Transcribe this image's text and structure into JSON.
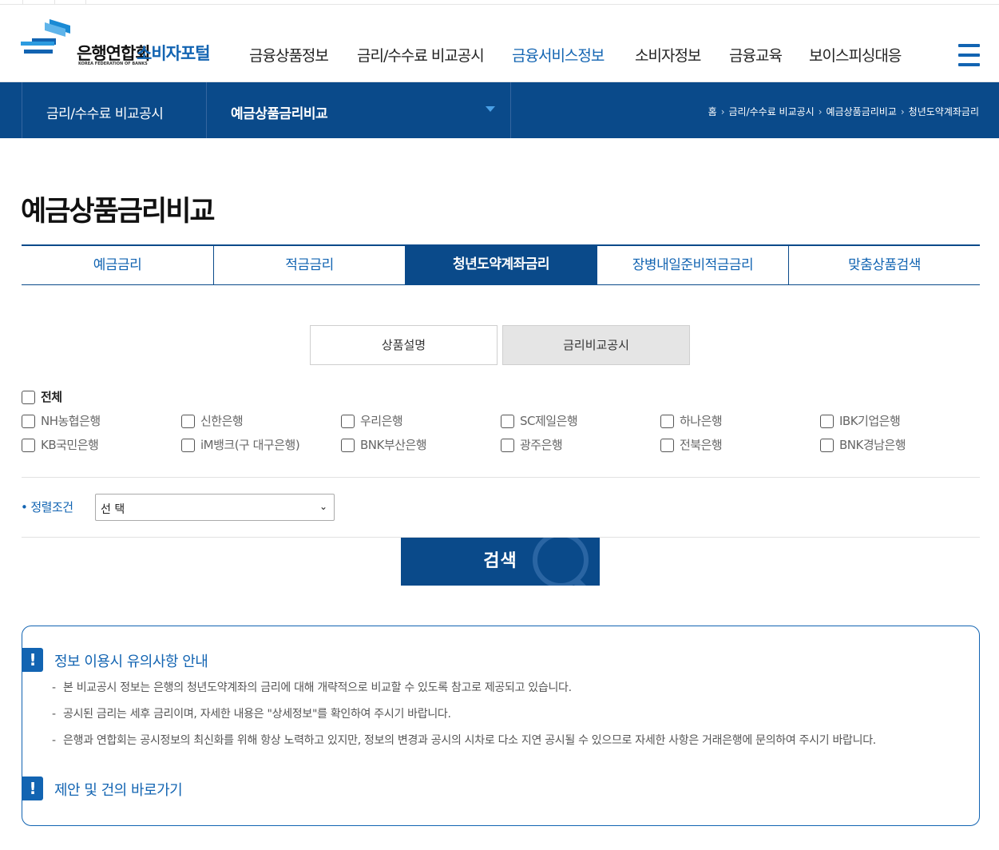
{
  "logo": {
    "org_name": "은행연합회",
    "org_name_en": "KOREA FEDERATION OF BANKS",
    "portal_name": "소비자포털"
  },
  "gnb": {
    "items": [
      {
        "label": "금융상품정보",
        "active": false
      },
      {
        "label": "금리/수수료 비교공시",
        "active": false
      },
      {
        "label": "금융서비스정보",
        "active": true
      },
      {
        "label": "소비자정보",
        "active": false
      },
      {
        "label": "금융교육",
        "active": false
      },
      {
        "label": "보이스피싱대응",
        "active": false
      }
    ],
    "menu_icon": "hamburger-icon"
  },
  "subbar": {
    "category": "금리/수수료 비교공시",
    "current": "예금상품금리비교",
    "breadcrumb": [
      "홈",
      "금리/수수료 비교공시",
      "예금상품금리비교",
      "청년도약계좌금리"
    ]
  },
  "page_title": "예금상품금리비교",
  "tabs": [
    {
      "label": "예금금리",
      "active": false
    },
    {
      "label": "적금금리",
      "active": false
    },
    {
      "label": "청년도약계좌금리",
      "active": true
    },
    {
      "label": "장병내일준비적금금리",
      "active": false
    },
    {
      "label": "맞춤상품검색",
      "active": false
    }
  ],
  "sub_buttons": [
    {
      "label": "상품설명",
      "active": false
    },
    {
      "label": "금리비교공시",
      "active": true
    }
  ],
  "banks": {
    "all_label": "전체",
    "row1": [
      "NH농협은행",
      "신한은행",
      "우리은행",
      "SC제일은행",
      "하나은행",
      "IBK기업은행"
    ],
    "row2": [
      "KB국민은행",
      "iM뱅크(구 대구은행)",
      "BNK부산은행",
      "광주은행",
      "전북은행",
      "BNK경남은행"
    ]
  },
  "sort": {
    "label": "정렬조건",
    "selected": "선 택"
  },
  "search_button": "검색",
  "notice": {
    "title1": "정보 이용시 유의사항 안내",
    "items": [
      "본 비교공시 정보는 은행의 청년도약계좌의 금리에 대해 개략적으로 비교할 수 있도록 참고로 제공되고 있습니다.",
      "공시된 금리는 세후 금리이며, 자세한 내용은 \"상세정보\"를 확인하여 주시기 바랍니다.",
      "은행과 연합회는 공시정보의 최신화를 위해 항상 노력하고 있지만, 정보의 변경과 공시의 시차로 다소 지연 공시될 수 있으므로 자세한 사항은 거래은행에 문의하여 주시기 바랍니다."
    ],
    "title2": "제안 및 건의 바로가기"
  },
  "colors": {
    "brand_blue": "#1264b2",
    "navy": "#0a4a8a"
  }
}
